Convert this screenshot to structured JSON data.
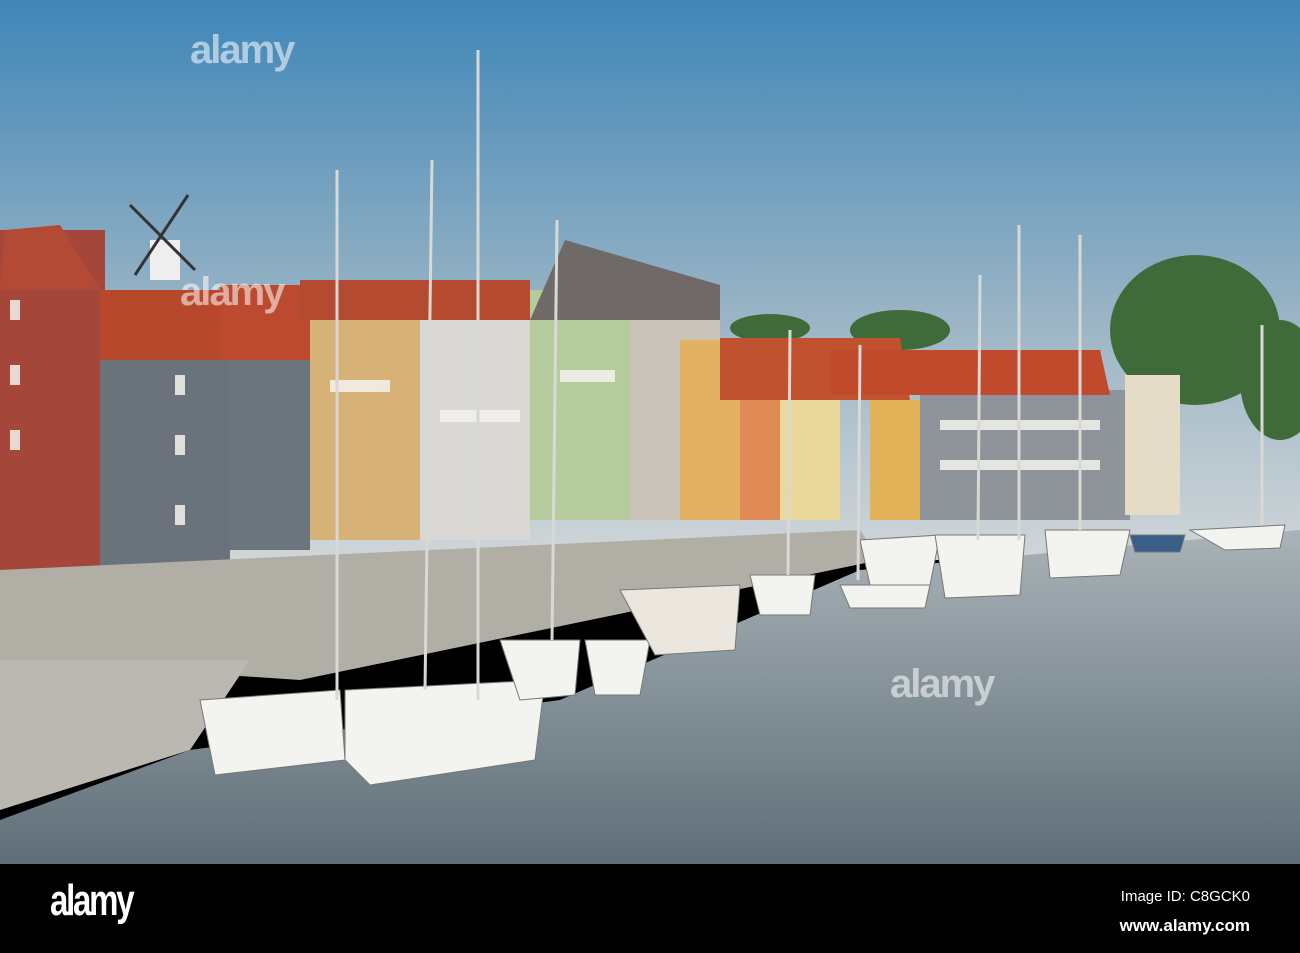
{
  "photo": {
    "subject": "harbor",
    "colors": {
      "sky_top": "#3f86b8",
      "sky_bottom": "#c9d3d8",
      "water": "#7e8a93",
      "roof": "#b8482c",
      "quay": "#b9b7b0"
    }
  },
  "watermark": {
    "text": "alamy"
  },
  "footer": {
    "logo": "alamy",
    "image_id": "Image ID: C8GCK0",
    "url": "www.alamy.com"
  }
}
